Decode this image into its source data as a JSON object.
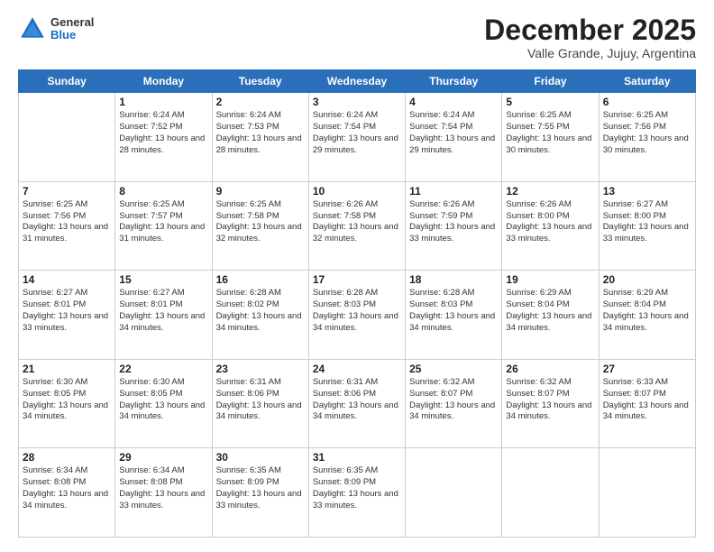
{
  "logo": {
    "line1": "General",
    "line2": "Blue"
  },
  "title": "December 2025",
  "subtitle": "Valle Grande, Jujuy, Argentina",
  "headers": [
    "Sunday",
    "Monday",
    "Tuesday",
    "Wednesday",
    "Thursday",
    "Friday",
    "Saturday"
  ],
  "weeks": [
    [
      {
        "day": "",
        "info": ""
      },
      {
        "day": "1",
        "info": "Sunrise: 6:24 AM\nSunset: 7:52 PM\nDaylight: 13 hours\nand 28 minutes."
      },
      {
        "day": "2",
        "info": "Sunrise: 6:24 AM\nSunset: 7:53 PM\nDaylight: 13 hours\nand 28 minutes."
      },
      {
        "day": "3",
        "info": "Sunrise: 6:24 AM\nSunset: 7:54 PM\nDaylight: 13 hours\nand 29 minutes."
      },
      {
        "day": "4",
        "info": "Sunrise: 6:24 AM\nSunset: 7:54 PM\nDaylight: 13 hours\nand 29 minutes."
      },
      {
        "day": "5",
        "info": "Sunrise: 6:25 AM\nSunset: 7:55 PM\nDaylight: 13 hours\nand 30 minutes."
      },
      {
        "day": "6",
        "info": "Sunrise: 6:25 AM\nSunset: 7:56 PM\nDaylight: 13 hours\nand 30 minutes."
      }
    ],
    [
      {
        "day": "7",
        "info": "Sunrise: 6:25 AM\nSunset: 7:56 PM\nDaylight: 13 hours\nand 31 minutes."
      },
      {
        "day": "8",
        "info": "Sunrise: 6:25 AM\nSunset: 7:57 PM\nDaylight: 13 hours\nand 31 minutes."
      },
      {
        "day": "9",
        "info": "Sunrise: 6:25 AM\nSunset: 7:58 PM\nDaylight: 13 hours\nand 32 minutes."
      },
      {
        "day": "10",
        "info": "Sunrise: 6:26 AM\nSunset: 7:58 PM\nDaylight: 13 hours\nand 32 minutes."
      },
      {
        "day": "11",
        "info": "Sunrise: 6:26 AM\nSunset: 7:59 PM\nDaylight: 13 hours\nand 33 minutes."
      },
      {
        "day": "12",
        "info": "Sunrise: 6:26 AM\nSunset: 8:00 PM\nDaylight: 13 hours\nand 33 minutes."
      },
      {
        "day": "13",
        "info": "Sunrise: 6:27 AM\nSunset: 8:00 PM\nDaylight: 13 hours\nand 33 minutes."
      }
    ],
    [
      {
        "day": "14",
        "info": "Sunrise: 6:27 AM\nSunset: 8:01 PM\nDaylight: 13 hours\nand 33 minutes."
      },
      {
        "day": "15",
        "info": "Sunrise: 6:27 AM\nSunset: 8:01 PM\nDaylight: 13 hours\nand 34 minutes."
      },
      {
        "day": "16",
        "info": "Sunrise: 6:28 AM\nSunset: 8:02 PM\nDaylight: 13 hours\nand 34 minutes."
      },
      {
        "day": "17",
        "info": "Sunrise: 6:28 AM\nSunset: 8:03 PM\nDaylight: 13 hours\nand 34 minutes."
      },
      {
        "day": "18",
        "info": "Sunrise: 6:28 AM\nSunset: 8:03 PM\nDaylight: 13 hours\nand 34 minutes."
      },
      {
        "day": "19",
        "info": "Sunrise: 6:29 AM\nSunset: 8:04 PM\nDaylight: 13 hours\nand 34 minutes."
      },
      {
        "day": "20",
        "info": "Sunrise: 6:29 AM\nSunset: 8:04 PM\nDaylight: 13 hours\nand 34 minutes."
      }
    ],
    [
      {
        "day": "21",
        "info": "Sunrise: 6:30 AM\nSunset: 8:05 PM\nDaylight: 13 hours\nand 34 minutes."
      },
      {
        "day": "22",
        "info": "Sunrise: 6:30 AM\nSunset: 8:05 PM\nDaylight: 13 hours\nand 34 minutes."
      },
      {
        "day": "23",
        "info": "Sunrise: 6:31 AM\nSunset: 8:06 PM\nDaylight: 13 hours\nand 34 minutes."
      },
      {
        "day": "24",
        "info": "Sunrise: 6:31 AM\nSunset: 8:06 PM\nDaylight: 13 hours\nand 34 minutes."
      },
      {
        "day": "25",
        "info": "Sunrise: 6:32 AM\nSunset: 8:07 PM\nDaylight: 13 hours\nand 34 minutes."
      },
      {
        "day": "26",
        "info": "Sunrise: 6:32 AM\nSunset: 8:07 PM\nDaylight: 13 hours\nand 34 minutes."
      },
      {
        "day": "27",
        "info": "Sunrise: 6:33 AM\nSunset: 8:07 PM\nDaylight: 13 hours\nand 34 minutes."
      }
    ],
    [
      {
        "day": "28",
        "info": "Sunrise: 6:34 AM\nSunset: 8:08 PM\nDaylight: 13 hours\nand 34 minutes."
      },
      {
        "day": "29",
        "info": "Sunrise: 6:34 AM\nSunset: 8:08 PM\nDaylight: 13 hours\nand 33 minutes."
      },
      {
        "day": "30",
        "info": "Sunrise: 6:35 AM\nSunset: 8:09 PM\nDaylight: 13 hours\nand 33 minutes."
      },
      {
        "day": "31",
        "info": "Sunrise: 6:35 AM\nSunset: 8:09 PM\nDaylight: 13 hours\nand 33 minutes."
      },
      {
        "day": "",
        "info": ""
      },
      {
        "day": "",
        "info": ""
      },
      {
        "day": "",
        "info": ""
      }
    ]
  ]
}
